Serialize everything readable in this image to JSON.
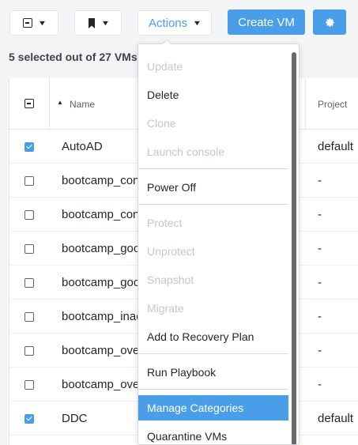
{
  "toolbar": {
    "actions_label": "Actions",
    "create_vm_label": "Create VM",
    "settings_icon": "gear-icon",
    "bulk_select_icon": "checkbox-minus-icon",
    "bookmark_icon": "bookmark-icon"
  },
  "selection_summary": "5 selected out of 27 VMs",
  "table": {
    "columns": {
      "name": "Name",
      "project": "Project"
    },
    "sort_indicator": "▲",
    "rows": [
      {
        "name": "AutoAD",
        "project": "default",
        "checked": true
      },
      {
        "name": "bootcamp_cons",
        "project": "-",
        "checked": false
      },
      {
        "name": "bootcamp_cons",
        "project": "-",
        "checked": false
      },
      {
        "name": "bootcamp_good",
        "project": "-",
        "checked": false
      },
      {
        "name": "bootcamp_good",
        "project": "-",
        "checked": false
      },
      {
        "name": "bootcamp_inact",
        "project": "-",
        "checked": false
      },
      {
        "name": "bootcamp_over",
        "project": "-",
        "checked": false
      },
      {
        "name": "bootcamp_over",
        "project": "-",
        "checked": false
      },
      {
        "name": "DDC",
        "project": "default",
        "checked": true
      }
    ]
  },
  "actions_menu": {
    "items": [
      {
        "label": "Update",
        "enabled": false
      },
      {
        "label": "Delete",
        "enabled": true
      },
      {
        "label": "Clone",
        "enabled": false
      },
      {
        "label": "Launch console",
        "enabled": false
      },
      {
        "label": "Power Off",
        "enabled": true
      },
      {
        "label": "Protect",
        "enabled": false
      },
      {
        "label": "Unprotect",
        "enabled": false
      },
      {
        "label": "Snapshot",
        "enabled": false
      },
      {
        "label": "Migrate",
        "enabled": false
      },
      {
        "label": "Add to Recovery Plan",
        "enabled": true
      },
      {
        "label": "Run Playbook",
        "enabled": true
      },
      {
        "label": "Manage Categories",
        "enabled": true,
        "highlighted": true
      },
      {
        "label": "Quarantine VMs",
        "enabled": true
      }
    ]
  },
  "colors": {
    "accent": "#4a9de8",
    "disabled_text": "#c2c7cd",
    "text": "#22272e"
  }
}
